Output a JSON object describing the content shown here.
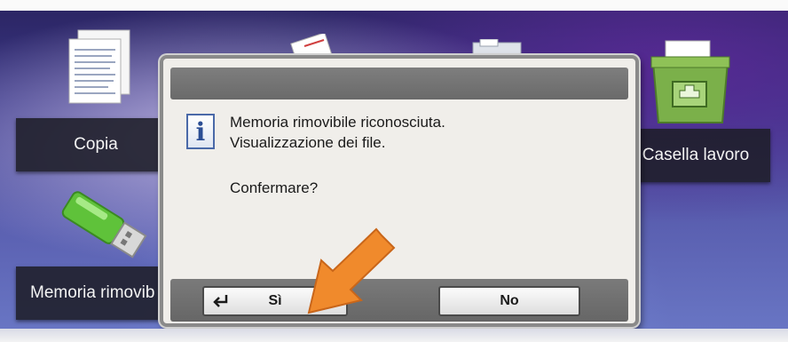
{
  "tiles": {
    "copia": "Copia",
    "memoria": "Memoria rimovib",
    "casella": "Casella lavoro"
  },
  "dialog": {
    "line1": "Memoria rimovibile riconosciuta.",
    "line2": "Visualizzazione dei file.",
    "question": "Confermare?",
    "yes_label": "Sì",
    "no_label": "No"
  },
  "icons": {
    "dialog": "info-icon",
    "yes_button": "enter-icon",
    "annotation": "orange-arrow"
  },
  "colors": {
    "annotation_arrow": "#f08a2c",
    "info_icon": "#2a4d94"
  }
}
